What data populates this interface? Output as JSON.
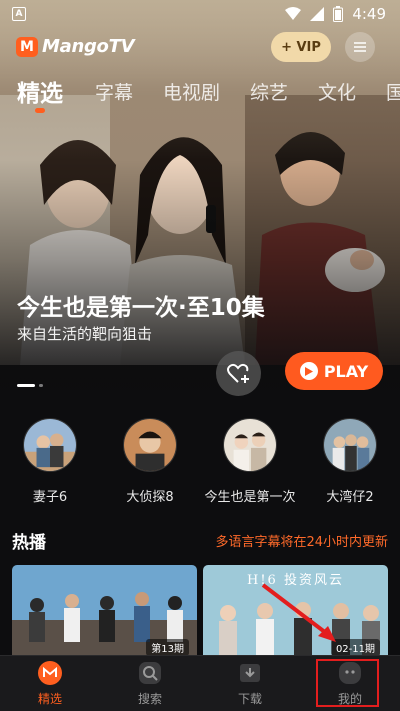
{
  "status_bar": {
    "time": "4:49",
    "left_icon": "A"
  },
  "header": {
    "logo_mark": "M",
    "logo_text": "MangoTV",
    "vip_label": "+ VIP"
  },
  "tabs": [
    "精选",
    "字幕",
    "电视剧",
    "综艺",
    "文化",
    "国"
  ],
  "hero": {
    "title": "今生也是第一次·至10集",
    "subtitle": "来自生活的靶向狙击",
    "play_label": "PLAY"
  },
  "stars": [
    "妻子6",
    "大侦探8",
    "今生也是第一次",
    "大湾仔2"
  ],
  "hot_section": {
    "heading": "热播",
    "notice": "多语言字幕将在24小时内更新"
  },
  "cards": [
    {
      "episode": "第13期"
    },
    {
      "title_art": "H!6 投资风云",
      "episode": "02-11期"
    }
  ],
  "bottom_nav": [
    "精选",
    "搜索",
    "下载",
    "我的"
  ],
  "colors": {
    "accent": "#ff5f1f",
    "vip_bg": "#f1d9a9",
    "annotation_red": "#e31e1e"
  }
}
